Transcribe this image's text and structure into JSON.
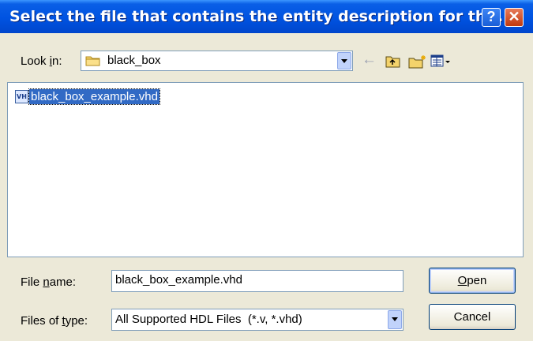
{
  "window": {
    "title": "Select the file that contains the entity description for th...",
    "help_glyph": "?",
    "close_glyph": "✕"
  },
  "lookin": {
    "label_prefix": "Look ",
    "label_accel": "i",
    "label_suffix": "n:",
    "value": "black_box",
    "folder_icon": "folder-icon"
  },
  "toolbar": {
    "back_glyph": "←",
    "icons": [
      "back-arrow-icon",
      "up-folder-icon",
      "new-folder-icon",
      "view-menu-icon"
    ]
  },
  "files": [
    {
      "name": "black_box_example.vhd",
      "icon_text": "VH",
      "selected": true
    }
  ],
  "filename": {
    "label_prefix": "File ",
    "label_accel": "n",
    "label_suffix": "ame:",
    "value": "black_box_example.vhd"
  },
  "filetype": {
    "label_prefix": "Files of ",
    "label_accel": "t",
    "label_suffix": "ype:",
    "value": "All Supported HDL Files  (*.v, *.vhd)"
  },
  "buttons": {
    "open_accel": "O",
    "open_rest": "pen",
    "cancel": "Cancel"
  },
  "colors": {
    "title_bar": "#0053E1",
    "selection": "#316AC5",
    "dialog_bg": "#ECE9D8"
  }
}
